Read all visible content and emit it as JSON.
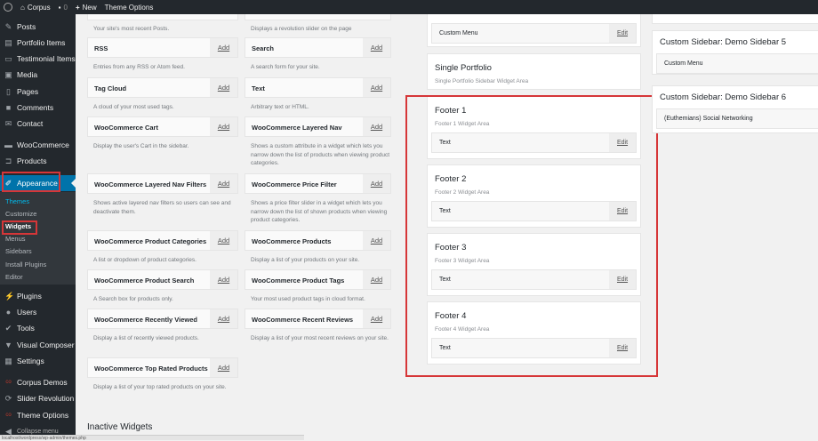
{
  "topbar": {
    "site": "Corpus",
    "comments": "0",
    "new": "New",
    "theme_options": "Theme Options"
  },
  "menu": [
    {
      "label": "Posts",
      "icon": "pin-icon"
    },
    {
      "label": "Portfolio Items",
      "icon": "portfolio-icon"
    },
    {
      "label": "Testimonial Items",
      "icon": "testimonial-icon"
    },
    {
      "label": "Media",
      "icon": "media-icon"
    },
    {
      "label": "Pages",
      "icon": "pages-icon"
    },
    {
      "label": "Comments",
      "icon": "comment-icon"
    },
    {
      "label": "Contact",
      "icon": "mail-icon"
    },
    {
      "label": "WooCommerce",
      "icon": "woocommerce-icon"
    },
    {
      "label": "Products",
      "icon": "cart-icon"
    },
    {
      "label": "Appearance",
      "icon": "brush-icon"
    },
    {
      "label": "Plugins",
      "icon": "plugin-icon"
    },
    {
      "label": "Users",
      "icon": "user-icon"
    },
    {
      "label": "Tools",
      "icon": "wrench-icon"
    },
    {
      "label": "Visual Composer",
      "icon": "vc-icon"
    },
    {
      "label": "Settings",
      "icon": "settings-icon"
    },
    {
      "label": "Corpus Demos",
      "icon": "corpus-icon"
    },
    {
      "label": "Slider Revolution",
      "icon": "slider-icon"
    },
    {
      "label": "Theme Options",
      "icon": "options-icon"
    },
    {
      "label": "Collapse menu",
      "icon": "collapse-icon"
    }
  ],
  "submenu": [
    "Themes",
    "Customize",
    "Widgets",
    "Menus",
    "Sidebars",
    "Install Plugins",
    "Editor"
  ],
  "add_label": "Add",
  "edit_label": "Edit",
  "left_top_desc": "Your site's most recent Posts.",
  "right_top_desc": "Displays a revolution slider on the page",
  "widgets_left": [
    {
      "title": "RSS",
      "desc": "Entries from any RSS or Atom feed."
    },
    {
      "title": "Tag Cloud",
      "desc": "A cloud of your most used tags."
    },
    {
      "title": "WooCommerce Cart",
      "desc": "Display the user's Cart in the sidebar."
    },
    {
      "title": "WooCommerce Layered Nav Filters",
      "desc": "Shows active layered nav filters so users can see and deactivate them."
    },
    {
      "title": "WooCommerce Product Categories",
      "desc": "A list or dropdown of product categories."
    },
    {
      "title": "WooCommerce Product Search",
      "desc": "A Search box for products only."
    },
    {
      "title": "WooCommerce Recently Viewed",
      "desc": "Display a list of recently viewed products."
    },
    {
      "title": "WooCommerce Top Rated Products",
      "desc": "Display a list of your top rated products on your site."
    }
  ],
  "widgets_right": [
    {
      "title": "Search",
      "desc": "A search form for your site."
    },
    {
      "title": "Text",
      "desc": "Arbitrary text or HTML."
    },
    {
      "title": "WooCommerce Layered Nav",
      "desc": "Shows a custom attribute in a widget which lets you narrow down the list of products when viewing product categories."
    },
    {
      "title": "WooCommerce Price Filter",
      "desc": "Shows a price filter slider in a widget which lets you narrow down the list of shown products when viewing product categories."
    },
    {
      "title": "WooCommerce Products",
      "desc": "Display a list of your products on your site."
    },
    {
      "title": "WooCommerce Product Tags",
      "desc": "Your most used product tags in cloud format."
    },
    {
      "title": "WooCommerce Recent Reviews",
      "desc": "Display a list of your most recent reviews on your site."
    }
  ],
  "top_custom_menu": "Custom Menu",
  "single_portfolio": {
    "title": "Single Portfolio",
    "sub": "Single Portfolio Sidebar Widget Area"
  },
  "footers": [
    {
      "title": "Footer 1",
      "sub": "Footer 1 Widget Area",
      "widget": "Text"
    },
    {
      "title": "Footer 2",
      "sub": "Footer 2 Widget Area",
      "widget": "Text"
    },
    {
      "title": "Footer 3",
      "sub": "Footer 3 Widget Area",
      "widget": "Text"
    },
    {
      "title": "Footer 4",
      "sub": "Footer 4 Widget Area",
      "widget": "Text"
    }
  ],
  "custom_sidebars": [
    {
      "title": "Custom Sidebar: Demo Sidebar 5",
      "widget": "Custom Menu"
    },
    {
      "title": "Custom Sidebar: Demo Sidebar 6",
      "widget": "(Euthemians) Social Networking"
    }
  ],
  "inactive_title": "Inactive Widgets",
  "status_url": "localhost/wordpress/wp-admin/themes.php"
}
